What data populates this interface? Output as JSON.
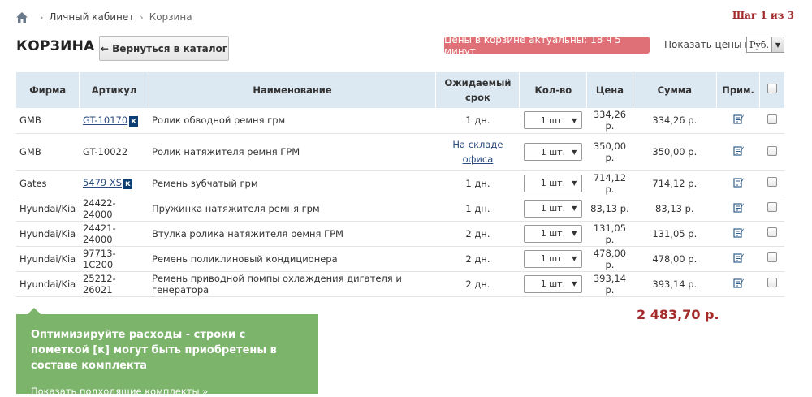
{
  "breadcrumb": {
    "items": [
      "Личный кабинет",
      "Корзина"
    ]
  },
  "step": "Шаг 1 из 3",
  "title": "КОРЗИНА",
  "back_button": "← Вернуться в каталог",
  "prices_badge": "Цены в корзине актуальны: 18 ч 5 минут",
  "show_prices_label": "Показать цены в:",
  "currency": "Руб.",
  "table": {
    "headers": {
      "firm": "Фирма",
      "article": "Артикул",
      "name": "Наименование",
      "term": "Ожидаемый срок",
      "qty": "Кол-во",
      "price": "Цена",
      "sum": "Сумма",
      "note": "Прим."
    },
    "rows": [
      {
        "firm": "GMB",
        "article": "GT-10170",
        "kit": "к",
        "name": "Ролик обводной ремня грм",
        "term": "1 дн.",
        "qty": "1 шт.",
        "price": "334,26 р.",
        "sum": "334,26 р."
      },
      {
        "firm": "GMB",
        "article": "GT-10022",
        "name": "Ролик натяжителя ремня ГРМ",
        "term_link": "На складе офиса",
        "qty": "1 шт.",
        "price": "350,00 р.",
        "sum": "350,00 р."
      },
      {
        "firm": "Gates",
        "article": "5479 XS",
        "kit": "к",
        "name": "Ремень зубчатый грм",
        "term": "1 дн.",
        "qty": "1 шт.",
        "price": "714,12 р.",
        "sum": "714,12 р."
      },
      {
        "firm": "Hyundai/Kia",
        "article": "24422-24000",
        "name": "Пружинка натяжителя ремня грм",
        "term": "1 дн.",
        "qty": "1 шт.",
        "price": "83,13 р.",
        "sum": "83,13 р."
      },
      {
        "firm": "Hyundai/Kia",
        "article": "24421-24000",
        "name": "Втулка ролика натяжителя ремня ГРМ",
        "term": "2 дн.",
        "qty": "1 шт.",
        "price": "131,05 р.",
        "sum": "131,05 р."
      },
      {
        "firm": "Hyundai/Kia",
        "article": "97713-1C200",
        "name": "Ремень поликлиновый кондиционера",
        "term": "2 дн.",
        "qty": "1 шт.",
        "price": "478,00 р.",
        "sum": "478,00 р."
      },
      {
        "firm": "Hyundai/Kia",
        "article": "25212-26021",
        "name": "Ремень приводной помпы охлаждения дигателя и генератора",
        "term": "2 дн.",
        "qty": "1 шт.",
        "price": "393,14 р.",
        "sum": "393,14 р."
      }
    ]
  },
  "total": "2 483,70 р.",
  "promo": {
    "message": "Оптимизируйте расходы - строки с пометкой [к] могут быть приобретены в составе комплекта",
    "link": "Показать подходящие комплекты »"
  },
  "colors": {
    "accent_red": "#a32b2b",
    "badge": "#e07077",
    "header_bg": "#dce8f2",
    "promo_green": "#7bb46a",
    "kit_badge": "#0c3e73"
  }
}
